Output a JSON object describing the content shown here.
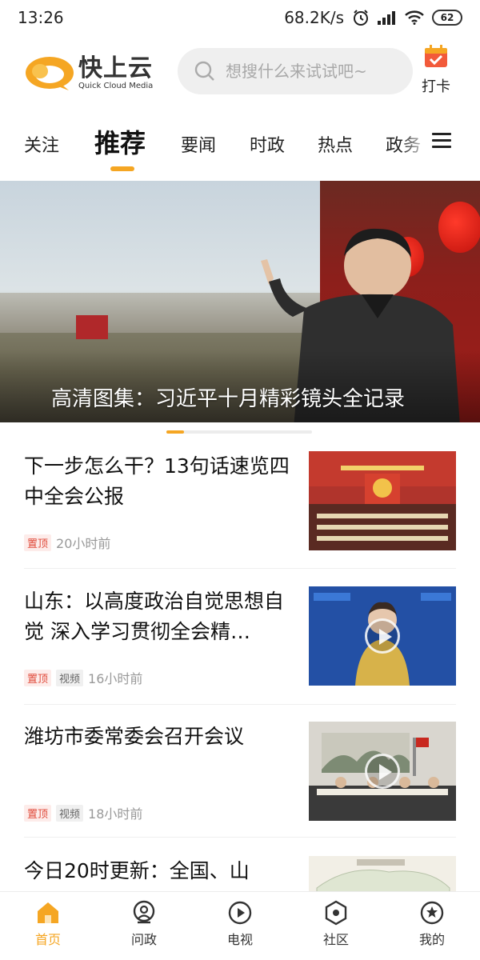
{
  "status_bar": {
    "time": "13:26",
    "network_speed": "68.2K/s",
    "battery": "62",
    "icons": [
      "alarm-icon",
      "signal-icon",
      "wifi-icon",
      "battery-icon"
    ]
  },
  "header": {
    "logo_cn": "快上云",
    "logo_en": "Quick Cloud Media",
    "search_placeholder": "想搜什么来试试吧~",
    "checkin_label": "打卡"
  },
  "tabs": [
    {
      "label": "关注",
      "active": false
    },
    {
      "label": "推荐",
      "active": true
    },
    {
      "label": "要闻",
      "active": false
    },
    {
      "label": "时政",
      "active": false
    },
    {
      "label": "热点",
      "active": false
    },
    {
      "label": "政务",
      "active": false
    }
  ],
  "banner": {
    "caption": "高清图集：习近平十月精彩镜头全记录",
    "slide_index": 1
  },
  "news": [
    {
      "title": "下一步怎么干？13句话速览四中全会公报",
      "tags": [
        "置顶"
      ],
      "time": "20小时前"
    },
    {
      "title": "山东：以高度政治自觉思想自觉 深入学习贯彻全会精…",
      "tags": [
        "置顶",
        "视频"
      ],
      "time": "16小时前"
    },
    {
      "title": "潍坊市委常委会召开会议",
      "tags": [
        "置顶",
        "视频"
      ],
      "time": "18小时前"
    },
    {
      "title": "今日20时更新：全国、山",
      "tags": [],
      "time": ""
    }
  ],
  "bottom_nav": [
    {
      "label": "首页",
      "icon": "home-icon",
      "active": true
    },
    {
      "label": "问政",
      "icon": "inquiry-icon",
      "active": false
    },
    {
      "label": "电视",
      "icon": "tv-play-icon",
      "active": false
    },
    {
      "label": "社区",
      "icon": "community-icon",
      "active": false
    },
    {
      "label": "我的",
      "icon": "profile-icon",
      "active": false
    }
  ],
  "colors": {
    "accent": "#f5a623",
    "tag_top": "#e04a3a"
  }
}
